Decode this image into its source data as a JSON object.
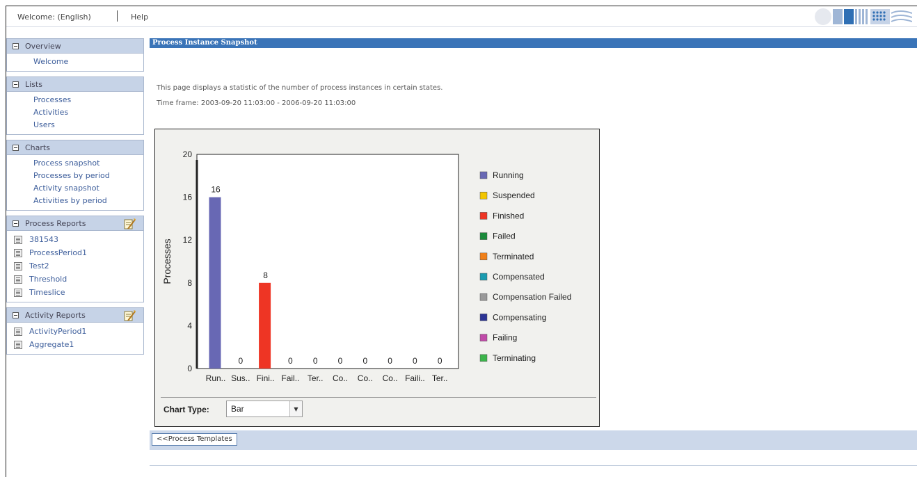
{
  "header": {
    "welcome": "Welcome: (English)",
    "help": "Help"
  },
  "sidebar": {
    "overview": {
      "title": "Overview",
      "items": [
        "Welcome"
      ]
    },
    "lists": {
      "title": "Lists",
      "items": [
        "Processes",
        "Activities",
        "Users"
      ]
    },
    "charts": {
      "title": "Charts",
      "items": [
        "Process snapshot",
        "Processes by period",
        "Activity snapshot",
        "Activities by period"
      ]
    },
    "process_reports": {
      "title": "Process Reports",
      "items": [
        "381543",
        "ProcessPeriod1",
        "Test2",
        "Threshold",
        "Timeslice"
      ]
    },
    "activity_reports": {
      "title": "Activity Reports",
      "items": [
        "ActivityPeriod1",
        "Aggregate1"
      ]
    }
  },
  "main": {
    "title": "Process Instance Snapshot",
    "description": "This page displays a statistic of the number of process instances in certain states.",
    "timeframe": "Time frame: 2003-09-20 11:03:00 - 2006-09-20 11:03:00",
    "chart_type_label": "Chart Type:",
    "chart_type_value": "Bar",
    "back_button": "<<Process Templates"
  },
  "chart_data": {
    "type": "bar",
    "ylabel": "Processes",
    "ylim": [
      0,
      20
    ],
    "yticks": [
      0,
      4,
      8,
      12,
      16,
      20
    ],
    "categories": [
      "Run..",
      "Sus..",
      "Fini..",
      "Fail..",
      "Ter..",
      "Co..",
      "Co..",
      "Co..",
      "Faili..",
      "Ter.."
    ],
    "values": [
      16,
      0,
      8,
      0,
      0,
      0,
      0,
      0,
      0,
      0
    ],
    "colors": [
      "#6868b4",
      "#f2c500",
      "#ee3524",
      "#1a8a3a",
      "#f08019",
      "#1a9bb0",
      "#999999",
      "#2c3495",
      "#c04aa8",
      "#3cb44b"
    ],
    "legend": [
      "Running",
      "Suspended",
      "Finished",
      "Failed",
      "Terminated",
      "Compensated",
      "Compensation Failed",
      "Compensating",
      "Failing",
      "Terminating"
    ],
    "legend_position": "right"
  }
}
